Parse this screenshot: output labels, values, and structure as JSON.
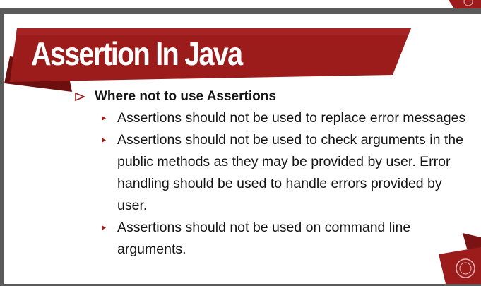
{
  "slide": {
    "title": "Assertion In Java",
    "heading": "Where not to use Assertions",
    "bullets": [
      "Assertions should not be used to replace error messages",
      "Assertions should not be used to check arguments in the public methods as they may be provided by user. Error handling should be used to handle errors provided by user.",
      "Assertions should not be used on command line arguments."
    ]
  },
  "colors": {
    "banner": "#9c1c1c",
    "banner_dark": "#6e0f0f",
    "bullet": "#a01d1d",
    "text": "#141414",
    "viewer_background": "#5a5a5a"
  },
  "icons": {
    "heading_marker": "hollow-triangle-right-icon",
    "bullet_marker": "small-triangle-right-icon",
    "corner_logo": "university-seal-icon"
  }
}
